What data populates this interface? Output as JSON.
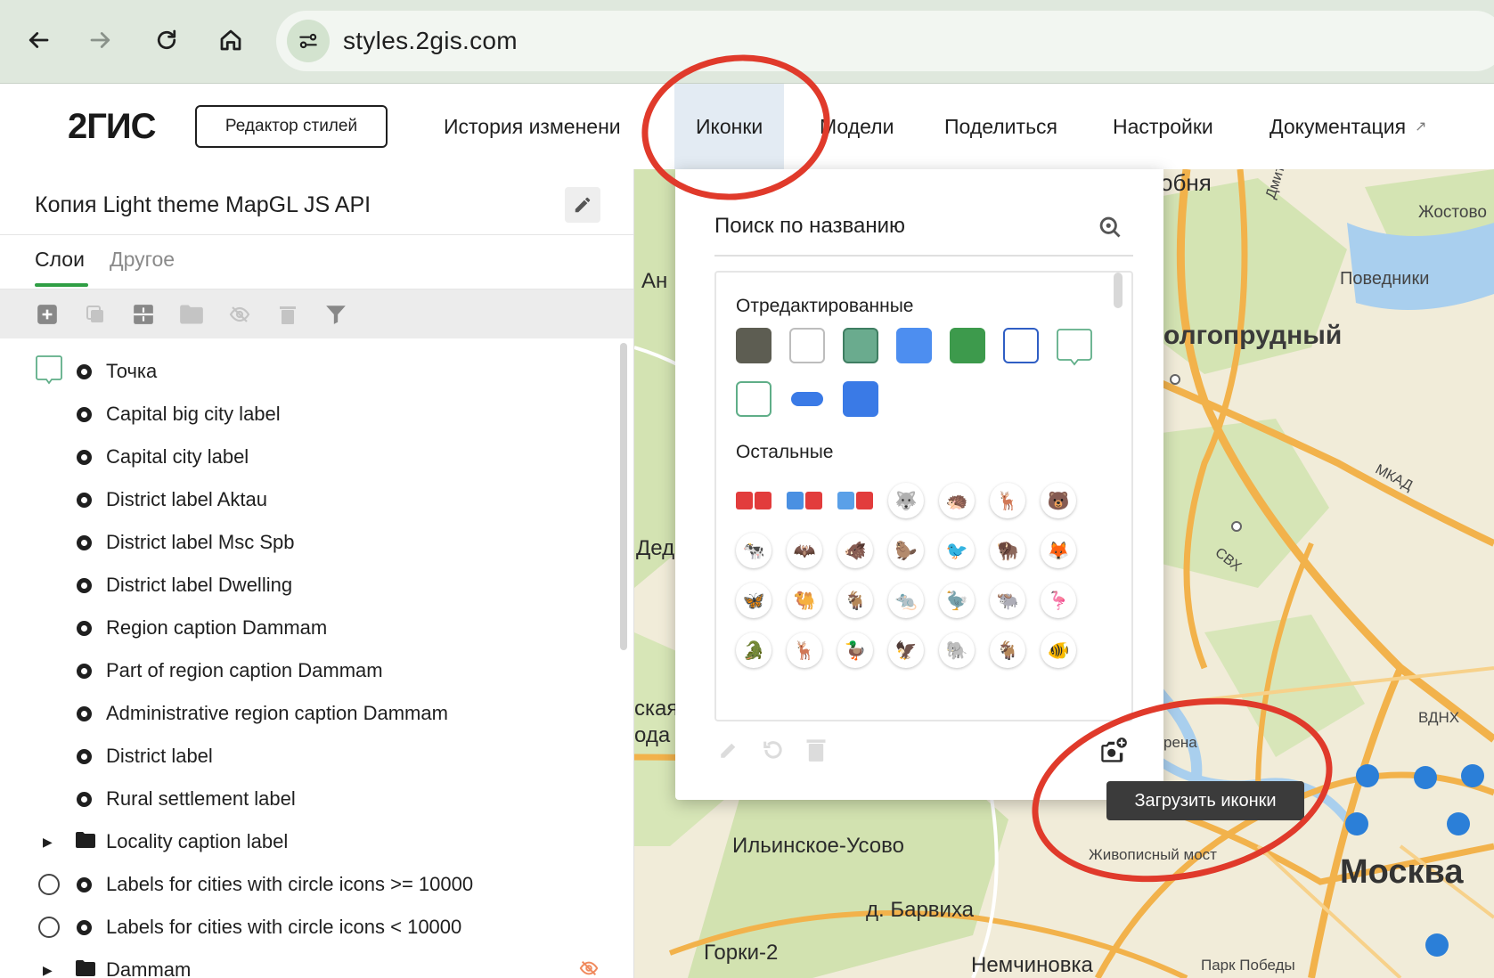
{
  "browser": {
    "url": "styles.2gis.com",
    "icons": [
      "back-icon",
      "forward-icon",
      "reload-icon",
      "home-icon",
      "site-settings-icon"
    ]
  },
  "header": {
    "logo": "2ГИС",
    "editor_button": "Редактор стилей",
    "menu": {
      "history": "История изменени",
      "icons": "Иконки",
      "models": "Модели",
      "share": "Поделиться",
      "settings": "Настройки",
      "docs": "Документация",
      "docs_arrow": "↗"
    }
  },
  "sidebar": {
    "title": "Копия Light theme MapGL JS API",
    "tabs": {
      "layers": "Слои",
      "other": "Другое"
    },
    "toolbar": [
      "add-layer-icon",
      "duplicate-icon",
      "split-icon",
      "folder-icon",
      "hide-icon",
      "delete-icon",
      "filter-icon"
    ],
    "layers": [
      {
        "label": "Точка",
        "kind": "point-bubble"
      },
      {
        "label": "Capital big city label",
        "kind": "dot"
      },
      {
        "label": "Capital city label",
        "kind": "dot"
      },
      {
        "label": "District label Aktau",
        "kind": "dot"
      },
      {
        "label": "District label Msc Spb",
        "kind": "dot"
      },
      {
        "label": "District label Dwelling",
        "kind": "dot"
      },
      {
        "label": "Region caption Dammam",
        "kind": "dot"
      },
      {
        "label": "Part of region caption Dammam",
        "kind": "dot"
      },
      {
        "label": "Administrative region caption Dammam",
        "kind": "dot"
      },
      {
        "label": "District label",
        "kind": "dot"
      },
      {
        "label": "Rural settlement label",
        "kind": "dot"
      },
      {
        "label": "Locality caption label",
        "kind": "folder"
      },
      {
        "label": "Labels for cities with circle icons >= 10000",
        "kind": "circle-dot"
      },
      {
        "label": "Labels for cities with circle icons < 10000",
        "kind": "circle-dot"
      },
      {
        "label": "Dammam",
        "kind": "folder-hidden"
      }
    ]
  },
  "icons_popup": {
    "search_placeholder": "Поиск по названию",
    "edited_title": "Отредактированные",
    "others_title": "Остальные",
    "edited_swatches": [
      {
        "fill": "#5d5d52",
        "border": "#5d5d52",
        "shape": "square"
      },
      {
        "fill": "#ffffff",
        "border": "#bdbdbd",
        "shape": "square"
      },
      {
        "fill": "#6aab8e",
        "border": "#3f7e62",
        "shape": "square"
      },
      {
        "fill": "#4d8ef0",
        "border": "#4d8ef0",
        "shape": "square"
      },
      {
        "fill": "#3d9a4c",
        "border": "#3d9a4c",
        "shape": "square"
      },
      {
        "fill": "#ffffff",
        "border": "#2f5ec4",
        "shape": "square"
      },
      {
        "fill": "#ffffff",
        "border": "#5fae88",
        "shape": "bubble"
      },
      {
        "fill": "#ffffff",
        "border": "#5fae88",
        "shape": "square"
      },
      {
        "fill": "#3a7ae6",
        "border": "#3a7ae6",
        "shape": "pill"
      },
      {
        "fill": "#3a7ae6",
        "border": "#3a7ae6",
        "shape": "square"
      }
    ],
    "animal_icons": [
      "metro-badge-icon",
      "metro-badge-icon",
      "metro-badge-icon",
      "wolf-icon",
      "pangolin-icon",
      "deer-icon",
      "bear-icon",
      "cow-icon",
      "bat-icon",
      "boar-icon",
      "beaver-icon",
      "bird-icon",
      "bison-icon",
      "fox-icon",
      "butterfly-icon",
      "camel-icon",
      "ibex-icon",
      "mole-icon",
      "ostrich-icon",
      "buffalo-icon",
      "crane-icon",
      "crocodile-icon",
      "stag-icon",
      "duck-icon",
      "eagle-icon",
      "elephant-icon",
      "antelope-icon",
      "clownfish-icon"
    ],
    "upload_tooltip": "Загрузить иконки",
    "footer_icons": [
      "edit-icon",
      "undo-icon",
      "trash-icon",
      "upload-icons-icon"
    ]
  },
  "map": {
    "labels": {
      "a1": "обня",
      "a2": "Жостово",
      "a3": "Дмитровское шо",
      "a4": "Поведники",
      "a5": "Ан",
      "a6": "олгопрудный",
      "a7": "МКАД",
      "a8": "СВХ",
      "a9": "Дед",
      "a10": "ВДНХ",
      "a11": "ская",
      "a12": "ода",
      "a13": "рена",
      "a14": "Ильинское-Усово",
      "a15": "Живописный мост",
      "a16": "Москва",
      "a17": "д. Барвиха",
      "a18": "Горки-2",
      "a19": "Немчиновка",
      "a20": "Парк Победы"
    }
  }
}
